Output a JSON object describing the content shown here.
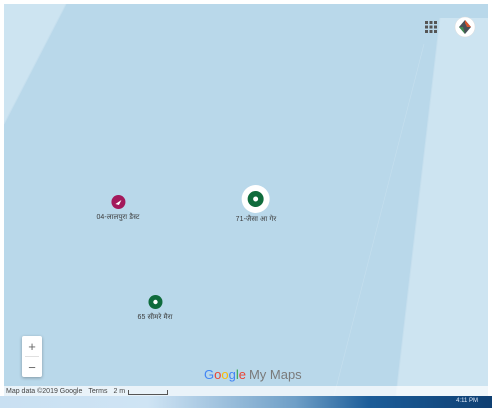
{
  "map": {
    "background_color": "#b9d8ea",
    "road_color": "#cde4f1",
    "markers": [
      {
        "label": "04-लालपुरा डैस्ट",
        "color": "#a3195b",
        "icon": "pin-icon",
        "selected": false
      },
      {
        "label": "71-जैसा आ गेर",
        "color": "#0f6b3c",
        "icon": "pin-icon",
        "selected": true
      },
      {
        "label": "65 सीमरे मैरा",
        "color": "#0f6b3c",
        "icon": "pin-icon",
        "selected": false
      }
    ]
  },
  "top_controls": {
    "apps_icon": "apps-grid-icon",
    "account_icon": "account-avatar-icon"
  },
  "zoom": {
    "in_label": "+",
    "out_label": "−"
  },
  "brand": {
    "g1": "G",
    "g2": "o",
    "g3": "o",
    "g4": "g",
    "g5": "l",
    "g6": "e",
    "product": "My Maps"
  },
  "attribution": {
    "map_data": "Map data ©2019 Google",
    "terms": "Terms",
    "scale": "2 m"
  },
  "taskbar": {
    "clock": "4:11 PM"
  }
}
